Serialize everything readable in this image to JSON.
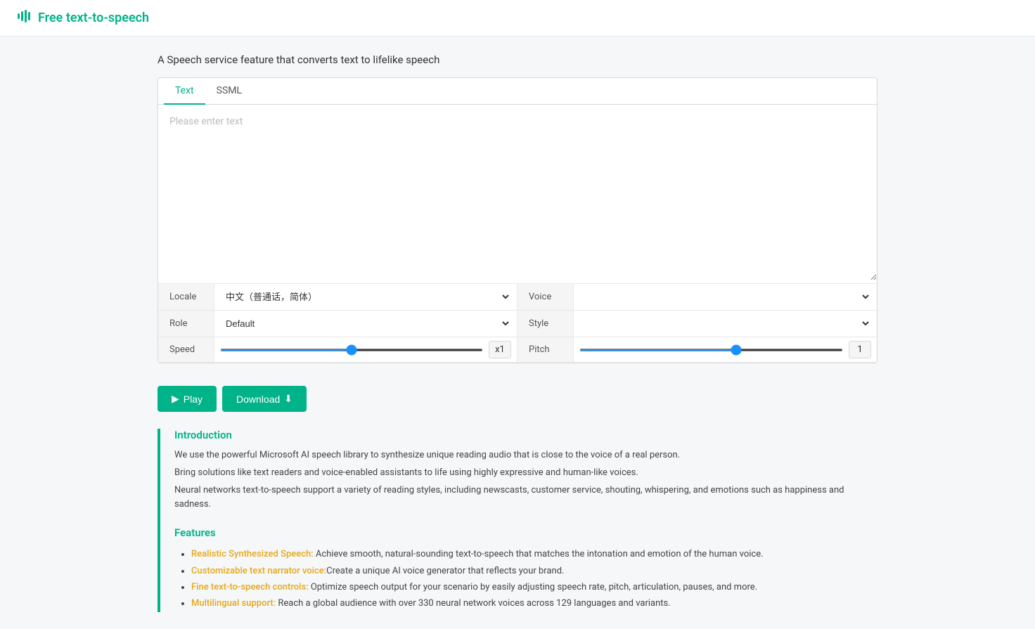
{
  "header": {
    "icon": "🎙",
    "title": "Free text-to-speech"
  },
  "subtitle": "A Speech service feature that converts text to lifelike speech",
  "tabs": [
    {
      "label": "Text",
      "active": true
    },
    {
      "label": "SSML",
      "active": false
    }
  ],
  "textarea": {
    "placeholder": "Please enter text"
  },
  "controls": {
    "locale_label": "Locale",
    "locale_value": "中文（普通话，简体）",
    "voice_label": "Voice",
    "voice_value": "",
    "role_label": "Role",
    "role_value": "Default",
    "style_label": "Style",
    "style_value": "",
    "speed_label": "Speed",
    "speed_value": 50,
    "speed_display": "x1",
    "pitch_label": "Pitch",
    "pitch_value": 60,
    "pitch_display": "1"
  },
  "buttons": {
    "play_label": "Play",
    "download_label": "Download"
  },
  "info": {
    "intro_title": "Introduction",
    "intro_lines": [
      "We use the powerful Microsoft AI speech library to synthesize unique reading audio that is close to the voice of a real person.",
      "Bring solutions like text readers and voice-enabled assistants to life using highly expressive and human-like voices.",
      "Neural networks text-to-speech support a variety of reading styles, including newscasts, customer service, shouting, whispering, and emotions such as happiness and sadness."
    ],
    "features_title": "Features",
    "features": [
      {
        "link": "Realistic Synthesized Speech:",
        "text": " Achieve smooth, natural-sounding text-to-speech that matches the intonation and emotion of the human voice."
      },
      {
        "link": "Customizable text narrator voice:",
        "text": "Create a unique AI voice generator that reflects your brand."
      },
      {
        "link": "Fine text-to-speech controls:",
        "text": " Optimize speech output for your scenario by easily adjusting speech rate, pitch, articulation, pauses, and more."
      },
      {
        "link": "Multilingual support:",
        "text": " Reach a global audience with over 330 neural network voices across 129 languages and variants."
      }
    ]
  }
}
